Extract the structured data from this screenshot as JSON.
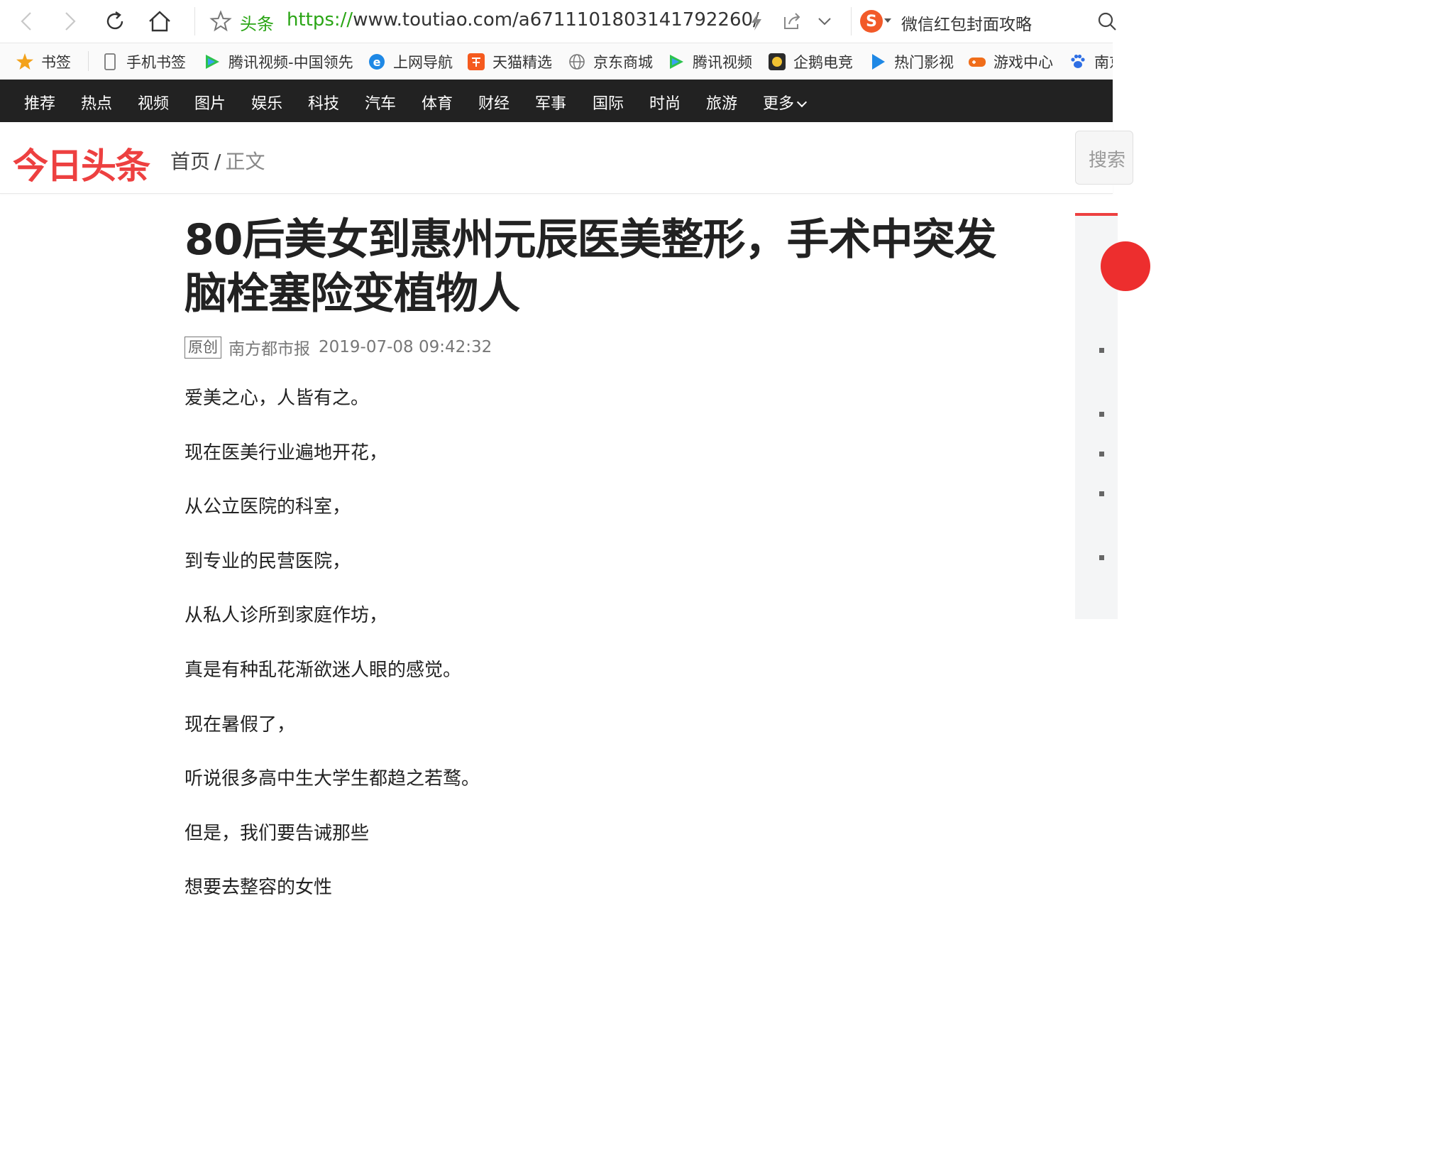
{
  "browser": {
    "url_tag": "头条",
    "url_protocol": "https://",
    "url_rest": "www.toutiao.com/a6711101803141792260/",
    "search_hint": "微信红包封面攻略",
    "icons": [
      "back-icon",
      "forward-icon",
      "refresh-icon",
      "home-icon",
      "star-icon",
      "lightning-icon",
      "share-icon",
      "chevron-down-icon",
      "sogou-search-icon",
      "search-icon"
    ]
  },
  "bookmarks": [
    {
      "label": "书签",
      "icon": "star-icon"
    },
    {
      "label": "手机书签",
      "icon": "phone-icon"
    },
    {
      "label": "腾讯视频-中国领先",
      "icon": "tencent-video-icon"
    },
    {
      "label": "上网导航",
      "icon": "ie-icon"
    },
    {
      "label": "天猫精选",
      "icon": "taobao-icon"
    },
    {
      "label": "京东商城",
      "icon": "globe-icon"
    },
    {
      "label": "腾讯视频",
      "icon": "tencent-video-icon"
    },
    {
      "label": "企鹅电竞",
      "icon": "penguin-esports-icon"
    },
    {
      "label": "热门影视",
      "icon": "play-icon"
    },
    {
      "label": "游戏中心",
      "icon": "gamepad-icon"
    },
    {
      "label": "南京",
      "icon": "baidu-paw-icon"
    }
  ],
  "channels": [
    "推荐",
    "热点",
    "视频",
    "图片",
    "娱乐",
    "科技",
    "汽车",
    "体育",
    "财经",
    "军事",
    "国际",
    "时尚",
    "旅游",
    "更多"
  ],
  "header": {
    "logo": "今日头条",
    "breadcrumb_home": "首页",
    "breadcrumb_sep": "/",
    "breadcrumb_current": "正文",
    "search_label": "搜索"
  },
  "article": {
    "title": "80后美女到惠州元辰医美整形，手术中突发脑栓塞险变植物人",
    "tag": "原创",
    "source": "南方都市报",
    "time": "2019-07-08 09:42:32",
    "paragraphs": [
      "爱美之心，人皆有之。",
      "现在医美行业遍地开花，",
      "从公立医院的科室，",
      "到专业的民营医院，",
      "从私人诊所到家庭作坊，",
      "真是有种乱花渐欲迷人眼的感觉。",
      "现在暑假了，",
      "听说很多高中生大学生都趋之若鹜。",
      "但是，我们要告诫那些",
      "想要去整容的女性"
    ]
  },
  "colors": {
    "brand_red": "#ed4040",
    "nav_bg": "#222222",
    "url_green": "#2aa515",
    "sogou_orange": "#f25a29"
  }
}
